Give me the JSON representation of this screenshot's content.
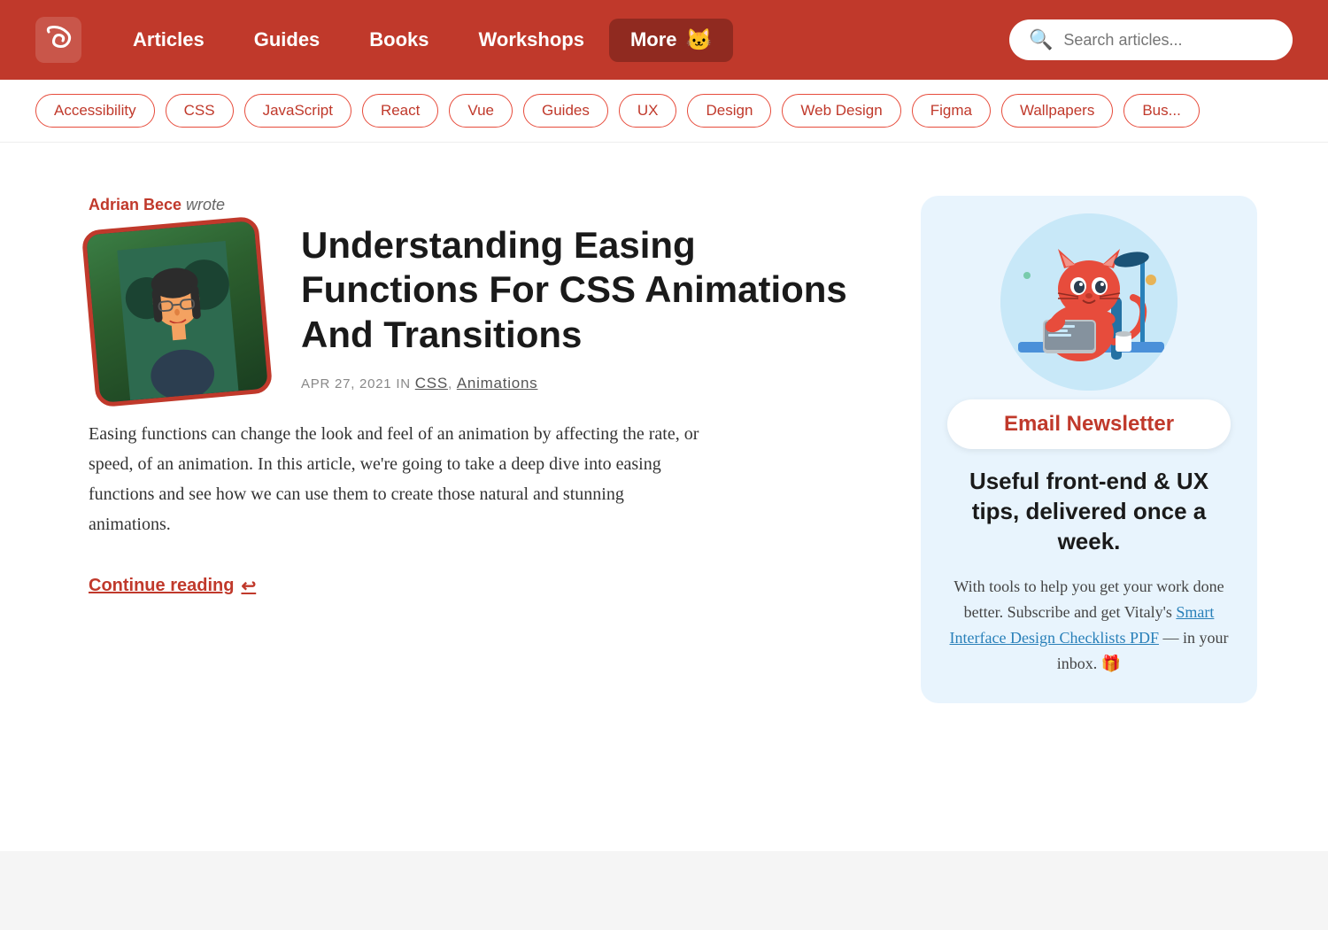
{
  "header": {
    "logo_letter": "S",
    "nav": [
      {
        "label": "Articles",
        "key": "articles"
      },
      {
        "label": "Guides",
        "key": "guides"
      },
      {
        "label": "Books",
        "key": "books"
      },
      {
        "label": "Workshops",
        "key": "workshops"
      },
      {
        "label": "More",
        "key": "more"
      }
    ],
    "search_placeholder": "Search articles..."
  },
  "tags": [
    "Accessibility",
    "CSS",
    "JavaScript",
    "React",
    "Vue",
    "Guides",
    "UX",
    "Design",
    "Web Design",
    "Figma",
    "Wallpapers",
    "Bus..."
  ],
  "article": {
    "author_name": "Adrian Bece",
    "wrote_text": " wrote",
    "title": "Understanding Easing Functions For CSS Animations And Transitions",
    "date_line": "APR 27, 2021",
    "in_text": "in",
    "categories": [
      "CSS",
      "Animations"
    ],
    "excerpt": "Easing functions can change the look and feel of an animation by affecting the rate, or speed, of an animation. In this article, we're going to take a deep dive into easing functions and see how we can use them to create those natural and stunning animations.",
    "continue_reading": "Continue reading",
    "continue_arrow": "↩"
  },
  "sidebar": {
    "newsletter_label": "Email Newsletter",
    "headline": "Useful front-end & UX tips, delivered once a week.",
    "body_text": "With tools to help you get your work done better. Subscribe and get Vitaly's ",
    "link_text": "Smart Interface Design Checklists PDF",
    "end_text": " — in your inbox. 🎁"
  }
}
